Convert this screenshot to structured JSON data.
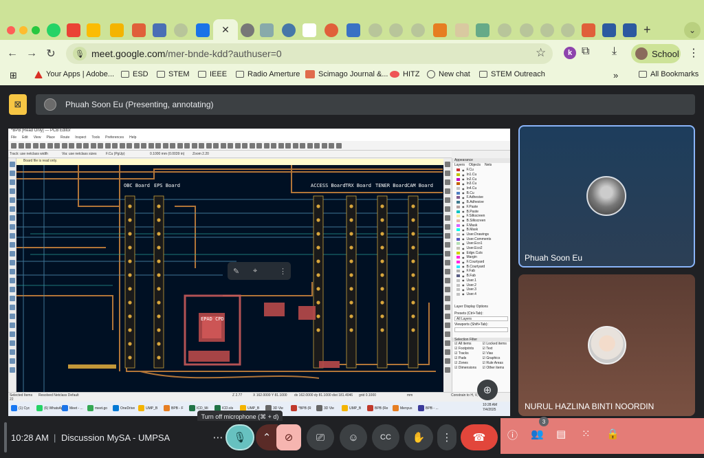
{
  "browser": {
    "url_host": "meet.google.com",
    "url_path": "/mer-bnde-kdd?authuser=0",
    "profile_name": "School",
    "active_tab_close": "✕",
    "new_tab": "+",
    "bookmarks": [
      {
        "label": "Your Apps | Adobe..."
      },
      {
        "label": "ESD"
      },
      {
        "label": "STEM"
      },
      {
        "label": "IEEE"
      },
      {
        "label": "Radio Amerture"
      },
      {
        "label": "Scimago Journal &..."
      },
      {
        "label": "HITZ"
      },
      {
        "label": "New chat"
      },
      {
        "label": "STEM Outreach"
      }
    ],
    "bookmarks_overflow": "»",
    "all_bookmarks": "All Bookmarks"
  },
  "meet": {
    "presenter_label": "Phuah Soon Eu (Presenting, annotating)",
    "participants": [
      {
        "name": "Phuah Soon Eu"
      },
      {
        "name": "NURUL HAZLINA BINTI NOORDIN"
      }
    ],
    "time": "10:28 AM",
    "separator": "|",
    "meeting_name": "Discussion MySA - UMPSA",
    "tooltip": "Turn off microphone (⌘ + d)",
    "people_count": "3",
    "colors": {
      "mic_active": "#67c1c0",
      "camera_off": "#f6b5b0",
      "end_call": "#e2463b",
      "right_panel": "#e47c77"
    }
  },
  "pcb": {
    "title": "*BPB [Read Only] — PCB Editor",
    "menu": [
      "File",
      "Edit",
      "View",
      "Place",
      "Route",
      "Inspect",
      "Tools",
      "Preferences",
      "Help"
    ],
    "toolbar_fields": [
      "Track: use netclass width",
      "Via: use netclass sizes",
      "F.Cu (PgUp)",
      "0.1000 mm (0.0039 in)",
      "Zoom 2.20"
    ],
    "readonly_banner": "Board file is read only.",
    "board_labels": [
      "OBC Board",
      "EPS Board",
      "ACCESS Board",
      "TRX Board",
      "TENER Board",
      "CAM Board",
      "EPAD CPD"
    ],
    "appearance_title": "Appearance",
    "appearance_tabs": [
      "Layers",
      "Objects",
      "Nets"
    ],
    "layers": [
      "F.Cu",
      "In1.Cu",
      "In2.Cu",
      "In3.Cu",
      "In4.Cu",
      "B.Cu",
      "F.Adhesive",
      "B.Adhesive",
      "F.Paste",
      "B.Paste",
      "F.Silkscreen",
      "B.Silkscreen",
      "F.Mask",
      "B.Mask",
      "User.Drawings",
      "User.Comments",
      "User.Eco1",
      "User.Eco2",
      "Edge.Cuts",
      "Margin",
      "F.Courtyard",
      "B.Courtyard",
      "F.Fab",
      "B.Fab",
      "User.1",
      "User.2",
      "User.3",
      "User.4"
    ],
    "layer_colors": [
      "#c83434",
      "#c2c200",
      "#c200c2",
      "#c26100",
      "#c2c2c2",
      "#4d7fc4",
      "#845c8f",
      "#3f7b8f",
      "#b4a0a0",
      "#00c2c2",
      "#f2eda1",
      "#e8b2a7",
      "#d864ff",
      "#02ffee",
      "#c2c2c2",
      "#595bc4",
      "#b5e0b5",
      "#c2c2b5",
      "#d0d200",
      "#ff26e2",
      "#ff26e2",
      "#26e9ff",
      "#afafaf",
      "#585d84",
      "#c2c2c2",
      "#c2c2c2",
      "#c2c2c2",
      "#c2c2c2"
    ],
    "layer_display_options": "Layer Display Options",
    "presets_label": "Presets (Ctrl+Tab):",
    "presets_value": "All Layers",
    "viewports_label": "Viewports (Shift+Tab):",
    "selection_filter": "Selection Filter",
    "filters": [
      "All items",
      "Locked items",
      "Footprints",
      "Text",
      "Tracks",
      "Vias",
      "Pads",
      "Graphics",
      "Zones",
      "Rule Areas",
      "Dimensions",
      "Other items"
    ],
    "status": [
      "Selected Items 22",
      "Resolved Netclass Default",
      "Z 2.77",
      "X 162.0000 Y 81.1000",
      "dx 162.0000 dy 81.1000 dist 181.4046",
      "grid 0.1000",
      "mm",
      "Constrain to H, V, 45"
    ],
    "taskbar_items": [
      "(1) Cyc",
      "(6) WhatsApp",
      "Meet - ...",
      "meet.go",
      "OneDrive",
      "UMP_B",
      "BPB - F",
      "ICD_Mi",
      "ICD.xls",
      "UMP_B",
      "3D Vie",
      "*BPB (R",
      "3D Vie",
      "UMP_B",
      "BPB (Re",
      "Menyus",
      "BPB - ..."
    ],
    "taskbar_time": "10:28 AM",
    "taskbar_date": "7/4/2025"
  }
}
